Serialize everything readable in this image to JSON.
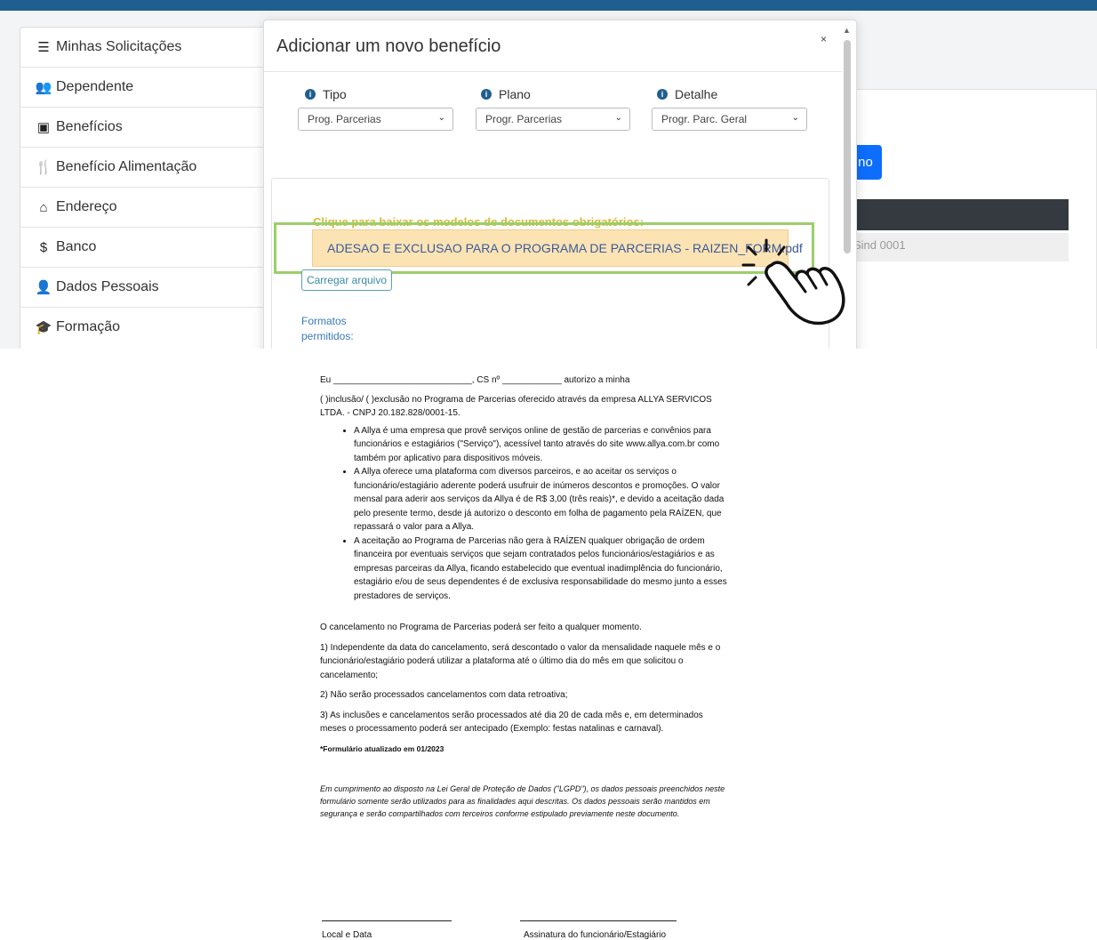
{
  "sidebar": {
    "items": [
      {
        "icon": "list-icon",
        "glyph": "☰",
        "label": "Minhas Solicitações"
      },
      {
        "icon": "users-icon",
        "glyph": "👥",
        "label": "Dependente"
      },
      {
        "icon": "medical-bag-icon",
        "glyph": "▣",
        "label": "Benefícios"
      },
      {
        "icon": "utensils-icon",
        "glyph": "🍴",
        "label": "Benefício Alimentação"
      },
      {
        "icon": "home-icon",
        "glyph": "⌂",
        "label": "Endereço"
      },
      {
        "icon": "dollar-icon",
        "glyph": "$",
        "label": "Banco"
      },
      {
        "icon": "user-lock-icon",
        "glyph": "👤",
        "label": "Dados Pessoais"
      },
      {
        "icon": "graduate-icon",
        "glyph": "🎓",
        "label": "Formação"
      }
    ]
  },
  "background": {
    "blue_button_label": "no",
    "sind_text": "Sind 0001"
  },
  "modal": {
    "title": "Adicionar um novo benefício",
    "close_label": "×",
    "fields": [
      {
        "label": "Tipo",
        "value": "Prog. Parcerias"
      },
      {
        "label": "Plano",
        "value": "Progr. Parcerias"
      },
      {
        "label": "Detalhe",
        "value": "Progr. Parc. Geral"
      }
    ],
    "instruction": "Clique para baixar os modelos de documentos obrigatórios:",
    "document_link": "ADESAO E EXCLUSAO PARA O PROGRAMA DE PARCERIAS - RAIZEN_FORM.pdf",
    "upload_label": "Carregar arquivo",
    "formats_label": "Formatos permitidos:"
  },
  "document": {
    "line1": "Eu ____________________________, CS nº ____________ autorizo a minha",
    "line2": "( )inclusão/ ( )exclusão no Programa de Parcerias oferecido através da empresa ALLYA SERVICOS LTDA. - CNPJ 20.182.828/0001-15.",
    "bullets": [
      "A Allya é uma empresa que provê serviços online de gestão de parcerias e convênios para funcionários e estagiários (\"Serviço\"), acessível tanto através do site www.allya.com.br como também por aplicativo para dispositivos móveis.",
      "A Allya oferece uma plataforma com diversos parceiros, e ao aceitar os serviços o funcionário/estagiário aderente poderá usufruir de inúmeros descontos e promoções. O valor mensal para aderir aos serviços da Allya é de R$ 3,00 (três reais)*, e devido a aceitação dada pelo presente termo, desde já autorizo o desconto em folha de pagamento pela RAÍZEN, que repassará o valor para a Allya.",
      "A aceitação ao Programa de Parcerias não gera à RAÍZEN qualquer obrigação de ordem financeira por eventuais serviços que sejam contratados pelos funcionários/estagiários e as empresas parceiras da Allya, ficando estabelecido que eventual inadimplência do funcionário, estagiário e/ou de seus dependentes é de exclusiva responsabilidade do mesmo junto a esses prestadores de serviços."
    ],
    "cancel_intro": "O cancelamento no Programa de Parcerias poderá ser feito a qualquer momento.",
    "rule1": "1) Independente da data do cancelamento, será descontado o valor da mensalidade naquele mês e o funcionário/estagiário poderá utilizar a plataforma até o último dia do mês em que solicitou o cancelamento;",
    "rule2": "2) Não serão processados cancelamentos com data retroativa;",
    "rule3": "3) As inclusões e cancelamentos serão processados até dia 20 de cada mês e, em determinados meses o processamento poderá ser antecipado (Exemplo: festas natalinas e carnaval).",
    "updated": "*Formulário atualizado em 01/2023",
    "lgpd": "Em cumprimento ao disposto na Lei Geral de Proteção de Dados (\"LGPD\"), os dados pessoais preenchidos neste formulário somente serão utilizados para as finalidades aqui descritas. Os dados pessoais serão mantidos em segurança e serão compartilhados com terceiros conforme estipulado previamente neste documento.",
    "sig_left": "Local e Data",
    "sig_right": "Assinatura do funcionário/Estagiário"
  }
}
